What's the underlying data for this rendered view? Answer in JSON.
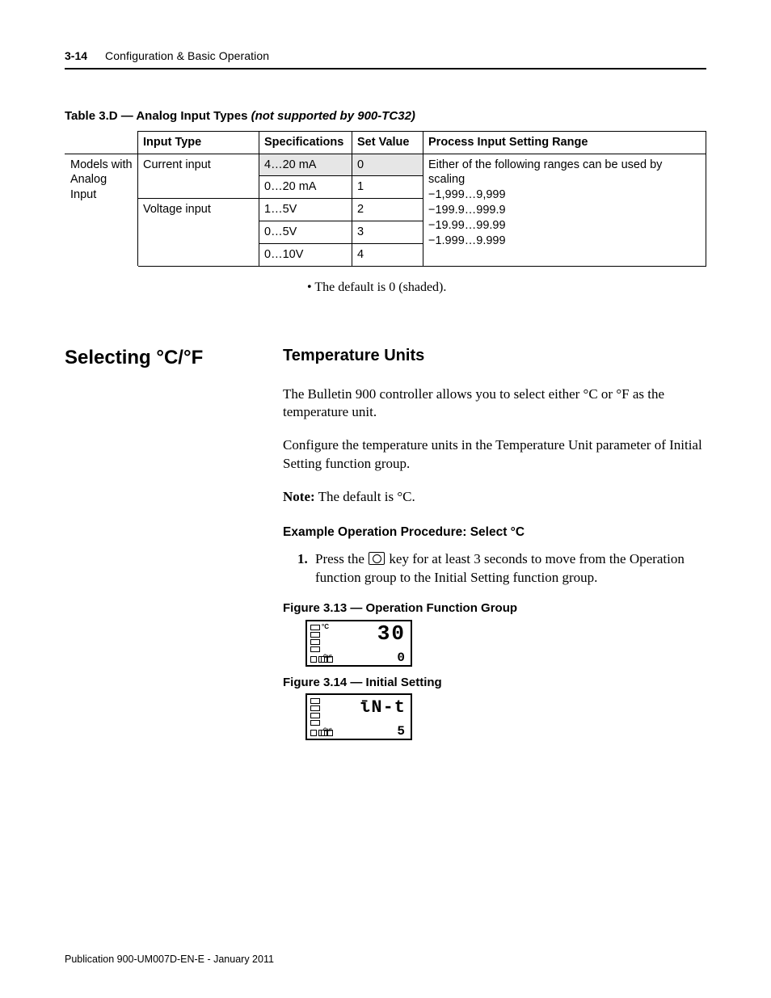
{
  "header": {
    "page_number": "3-14",
    "section_title": "Configuration & Basic Operation"
  },
  "table": {
    "caption_prefix": "Table 3.D — Analog Input Types ",
    "caption_italic": "(not supported by 900-TC32)",
    "columns": {
      "row_label_blank": "",
      "input_type": "Input Type",
      "specifications": "Specifications",
      "set_value": "Set Value",
      "process_range": "Process Input Setting Range"
    },
    "row_header_line1": "Models with",
    "row_header_line2": "Analog Input",
    "input_types": {
      "current": "Current input",
      "voltage": "Voltage input"
    },
    "range_text_line1": "Either of the following ranges can be used by scaling",
    "range_text_line2": "−1,999…9,999",
    "range_text_line3": "−199.9…999.9",
    "range_text_line4": "−19.99…99.99",
    "range_text_line5": "−1.999…9.999",
    "rows": [
      {
        "spec": "4…20 mA",
        "set": "0"
      },
      {
        "spec": "0…20 mA",
        "set": "1"
      },
      {
        "spec": "1…5V",
        "set": "2"
      },
      {
        "spec": "0…5V",
        "set": "3"
      },
      {
        "spec": "0…10V",
        "set": "4"
      }
    ],
    "footnote": "•  The default is 0 (shaded)."
  },
  "section": {
    "side_heading": "Selecting °C/°F",
    "sub_heading": "Temperature Units",
    "para1": "The Bulletin 900 controller allows you to select either °C or °F as the temperature unit.",
    "para2": "Configure the temperature units in the Temperature Unit parameter of Initial Setting function group.",
    "note_label": "Note:",
    "note_text": " The default is °C.",
    "proc_heading": "Example Operation Procedure: Select °C",
    "step1_num": "1.",
    "step1_text_a": "Press the ",
    "step1_text_b": " key for at least 3 seconds to move from the Operation function group to the Initial Setting function group.",
    "fig1_caption": "Figure 3.13 — Operation Function Group",
    "fig1_unit": "°C",
    "fig1_big": "30",
    "fig1_small": "0",
    "fig1_out": "Out",
    "fig2_caption": "Figure 3.14 — Initial Setting",
    "fig2_big": "ῑN-t",
    "fig2_small": "5",
    "fig2_out": "Out"
  },
  "footer": {
    "text": "Publication 900-UM007D-EN-E - January 2011"
  }
}
